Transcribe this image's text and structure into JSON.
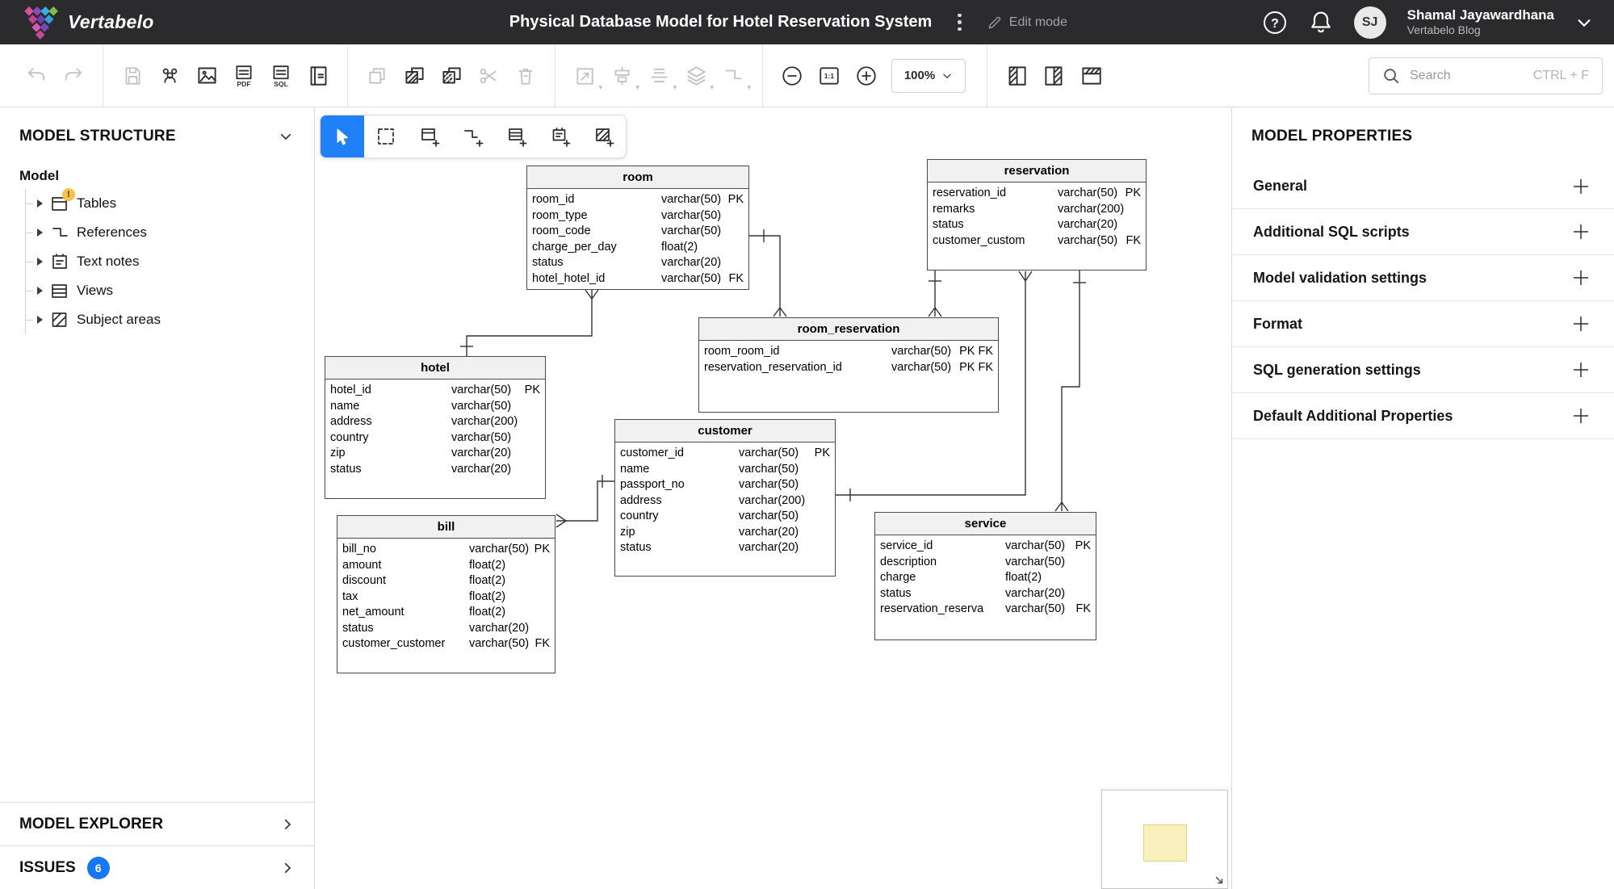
{
  "header": {
    "logo_text": "Vertabelo",
    "title": "Physical Database Model for Hotel Reservation System",
    "edit_mode_label": "Edit mode",
    "user": {
      "initials": "SJ",
      "name": "Shamal Jayawardhana",
      "subtitle": "Vertabelo Blog"
    }
  },
  "toolbar": {
    "export_pdf_label": "PDF",
    "export_sql_label": "SQL",
    "one_to_one_label": "1:1",
    "zoom_value": "100%",
    "search": {
      "placeholder": "Search",
      "shortcut": "CTRL + F"
    }
  },
  "left_sidebar": {
    "title": "MODEL STRUCTURE",
    "root_label": "Model",
    "items": [
      {
        "label": "Tables",
        "badge": "!"
      },
      {
        "label": "References"
      },
      {
        "label": "Text notes"
      },
      {
        "label": "Views"
      },
      {
        "label": "Subject areas"
      }
    ],
    "explorer_label": "MODEL EXPLORER",
    "issues_label": "ISSUES",
    "issues_count": "6"
  },
  "right_sidebar": {
    "title": "MODEL PROPERTIES",
    "sections": [
      "General",
      "Additional SQL scripts",
      "Model validation settings",
      "Format",
      "SQL generation settings",
      "Default Additional Properties"
    ]
  },
  "colors": {
    "topbar_bg": "#2b2b2d",
    "accent_blue": "#2080f7",
    "issues_badge_blue": "#1877f2",
    "warning_badge_yellow": "#f6c445",
    "table_header_bg": "#f1f1f1",
    "minimap_highlight": "#faf0bd"
  },
  "diagram": {
    "tables": [
      {
        "name": "room",
        "columns": [
          {
            "name": "room_id",
            "type": "varchar(50)",
            "keys": "PK"
          },
          {
            "name": "room_type",
            "type": "varchar(50)",
            "keys": ""
          },
          {
            "name": "room_code",
            "type": "varchar(50)",
            "keys": ""
          },
          {
            "name": "charge_per_day",
            "type": "float(2)",
            "keys": ""
          },
          {
            "name": "status",
            "type": "varchar(20)",
            "keys": ""
          },
          {
            "name": "hotel_hotel_id",
            "type": "varchar(50)",
            "keys": "FK"
          }
        ]
      },
      {
        "name": "reservation",
        "columns": [
          {
            "name": "reservation_id",
            "type": "varchar(50)",
            "keys": "PK"
          },
          {
            "name": "remarks",
            "type": "varchar(200)",
            "keys": ""
          },
          {
            "name": "status",
            "type": "varchar(20)",
            "keys": ""
          },
          {
            "name": "customer_custom",
            "type": "varchar(50)",
            "keys": "FK"
          }
        ]
      },
      {
        "name": "room_reservation",
        "columns": [
          {
            "name": "room_room_id",
            "type": "varchar(50)",
            "keys": "PK FK"
          },
          {
            "name": "reservation_reservation_id",
            "type": "varchar(50)",
            "keys": "PK FK"
          }
        ]
      },
      {
        "name": "hotel",
        "columns": [
          {
            "name": "hotel_id",
            "type": "varchar(50)",
            "keys": "PK"
          },
          {
            "name": "name",
            "type": "varchar(50)",
            "keys": ""
          },
          {
            "name": "address",
            "type": "varchar(200)",
            "keys": ""
          },
          {
            "name": "country",
            "type": "varchar(50)",
            "keys": ""
          },
          {
            "name": "zip",
            "type": "varchar(20)",
            "keys": ""
          },
          {
            "name": "status",
            "type": "varchar(20)",
            "keys": ""
          }
        ]
      },
      {
        "name": "customer",
        "columns": [
          {
            "name": "customer_id",
            "type": "varchar(50)",
            "keys": "PK"
          },
          {
            "name": "name",
            "type": "varchar(50)",
            "keys": ""
          },
          {
            "name": "passport_no",
            "type": "varchar(50)",
            "keys": ""
          },
          {
            "name": "address",
            "type": "varchar(200)",
            "keys": ""
          },
          {
            "name": "country",
            "type": "varchar(50)",
            "keys": ""
          },
          {
            "name": "zip",
            "type": "varchar(20)",
            "keys": ""
          },
          {
            "name": "status",
            "type": "varchar(20)",
            "keys": ""
          }
        ]
      },
      {
        "name": "bill",
        "columns": [
          {
            "name": "bill_no",
            "type": "varchar(50)",
            "keys": "PK"
          },
          {
            "name": "amount",
            "type": "float(2)",
            "keys": ""
          },
          {
            "name": "discount",
            "type": "float(2)",
            "keys": ""
          },
          {
            "name": "tax",
            "type": "float(2)",
            "keys": ""
          },
          {
            "name": "net_amount",
            "type": "float(2)",
            "keys": ""
          },
          {
            "name": "status",
            "type": "varchar(20)",
            "keys": ""
          },
          {
            "name": "customer_customer",
            "type": "varchar(50)",
            "keys": "FK"
          }
        ]
      },
      {
        "name": "service",
        "columns": [
          {
            "name": "service_id",
            "type": "varchar(50)",
            "keys": "PK"
          },
          {
            "name": "description",
            "type": "varchar(50)",
            "keys": ""
          },
          {
            "name": "charge",
            "type": "float(2)",
            "keys": ""
          },
          {
            "name": "status",
            "type": "varchar(20)",
            "keys": ""
          },
          {
            "name": "reservation_reserva",
            "type": "varchar(50)",
            "keys": "FK"
          }
        ]
      }
    ]
  }
}
